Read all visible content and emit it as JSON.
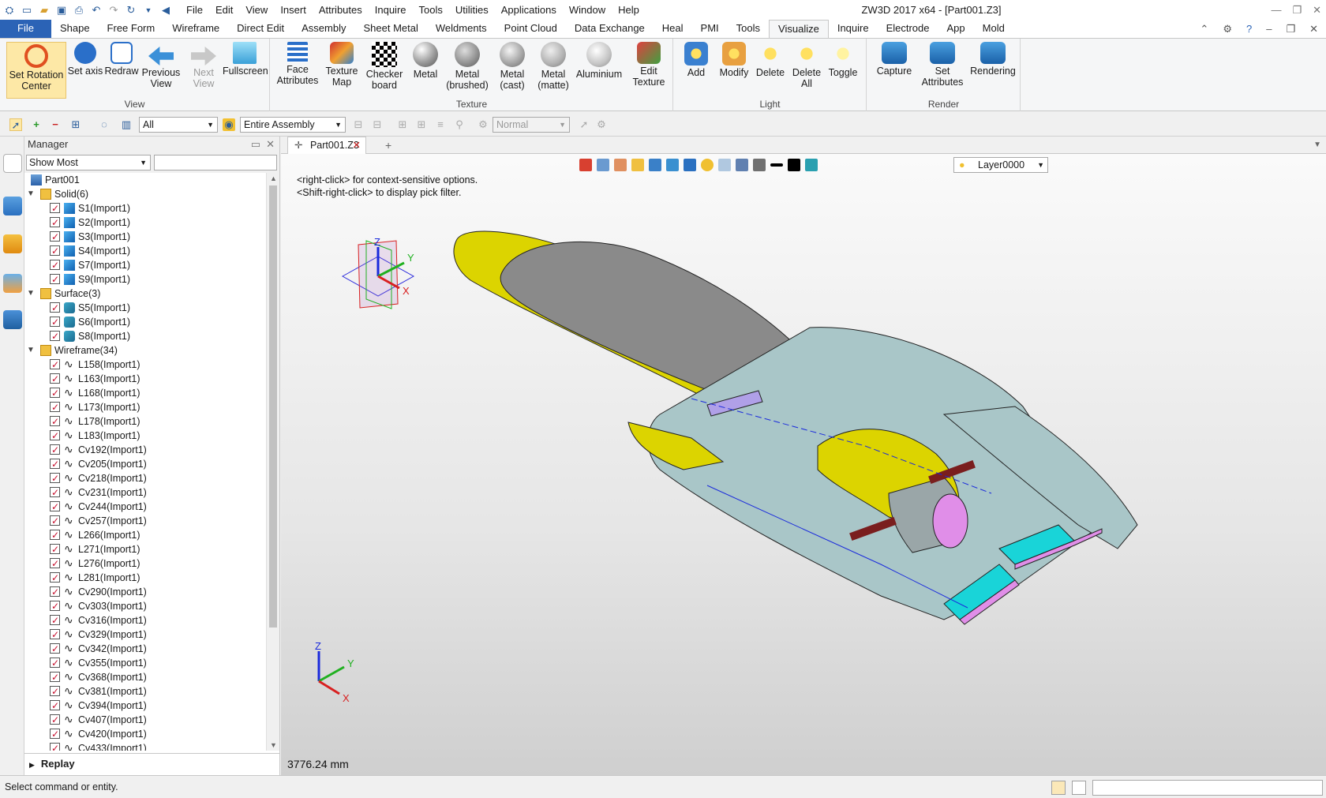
{
  "titlebar": {
    "app_title": "ZW3D 2017  x64 - [Part001.Z3]",
    "menus": [
      "File",
      "Edit",
      "View",
      "Insert",
      "Attributes",
      "Inquire",
      "Tools",
      "Utilities",
      "Applications",
      "Window",
      "Help"
    ]
  },
  "ribbon_tabs": [
    "File",
    "Shape",
    "Free Form",
    "Wireframe",
    "Direct Edit",
    "Assembly",
    "Sheet Metal",
    "Weldments",
    "Point Cloud",
    "Data Exchange",
    "Heal",
    "PMI",
    "Tools",
    "Visualize",
    "Inquire",
    "Electrode",
    "App",
    "Mold"
  ],
  "active_tab": "Visualize",
  "ribbon": {
    "view_group": {
      "label": "View",
      "buttons": [
        "Set Rotation Center",
        "Set axis",
        "Redraw",
        "Previous View",
        "Next View",
        "Fullscreen"
      ]
    },
    "texture_group": {
      "label": "Texture",
      "buttons": [
        "Face Attributes",
        "Texture Map",
        "Checker board",
        "Metal",
        "Metal (brushed)",
        "Metal (cast)",
        "Metal (matte)",
        "Aluminium",
        "Edit Texture"
      ]
    },
    "light_group": {
      "label": "Light",
      "buttons": [
        "Add",
        "Modify",
        "Delete",
        "Delete All",
        "Toggle"
      ]
    },
    "render_group": {
      "label": "Render",
      "buttons": [
        "Capture",
        "Set Attributes",
        "Rendering"
      ]
    }
  },
  "filterbar": {
    "filter_value": "All",
    "scope_value": "Entire Assembly",
    "mode_value": "Normal"
  },
  "manager": {
    "title": "Manager",
    "show_mode": "Show Most",
    "root": "Part001",
    "solid_header": "Solid(6)",
    "solids": [
      "S1(Import1)",
      "S2(Import1)",
      "S3(Import1)",
      "S4(Import1)",
      "S7(Import1)",
      "S9(Import1)"
    ],
    "surface_header": "Surface(3)",
    "surfaces": [
      "S5(Import1)",
      "S6(Import1)",
      "S8(Import1)"
    ],
    "wireframe_header": "Wireframe(34)",
    "wireframes": [
      "L158(Import1)",
      "L163(Import1)",
      "L168(Import1)",
      "L173(Import1)",
      "L178(Import1)",
      "L183(Import1)",
      "Cv192(Import1)",
      "Cv205(Import1)",
      "Cv218(Import1)",
      "Cv231(Import1)",
      "Cv244(Import1)",
      "Cv257(Import1)",
      "L266(Import1)",
      "L271(Import1)",
      "L276(Import1)",
      "L281(Import1)",
      "Cv290(Import1)",
      "Cv303(Import1)",
      "Cv316(Import1)",
      "Cv329(Import1)",
      "Cv342(Import1)",
      "Cv355(Import1)",
      "Cv368(Import1)",
      "Cv381(Import1)",
      "Cv394(Import1)",
      "Cv407(Import1)",
      "Cv420(Import1)",
      "Cv433(Import1)"
    ],
    "replay_label": "Replay"
  },
  "document_tab": "Part001.Z3",
  "viewport": {
    "hint_1": "<right-click> for context-sensitive options.",
    "hint_2": "<Shift-right-click> to display pick filter.",
    "layer": "Layer0000",
    "distance": "3776.24 mm",
    "axis_z": "Z",
    "axis_y": "Y",
    "axis_x": "X"
  },
  "status": {
    "message": "Select command or entity."
  },
  "colors": {
    "accent": "#2b63b6",
    "body_yellow": "#dcd400",
    "body_grey": "#8a8a8a",
    "body_teal": "#a9c6c8",
    "body_cyan": "#19d4d8",
    "body_pink": "#e08ee8"
  }
}
